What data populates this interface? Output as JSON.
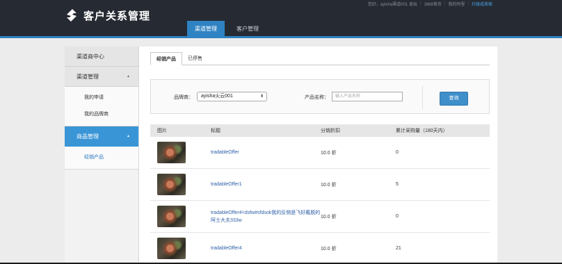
{
  "header": {
    "app_title": "客户关系管理",
    "top_links": {
      "greeting": "您好，ayisha渠道001 退出",
      "home": "1688首页",
      "my_ali": "我的阿里",
      "upgrade": "升级成卖家"
    },
    "nav": [
      {
        "label": "渠道管理"
      },
      {
        "label": "客户管理"
      }
    ]
  },
  "sidebar": {
    "section1": "渠道商中心",
    "section2": "渠道管理",
    "section2_items": [
      "我的申请",
      "我的品牌商"
    ],
    "section3": "商品管理",
    "section3_items": [
      "经销产品"
    ],
    "caret_up": "▲"
  },
  "tabs": [
    {
      "label": "经销产品"
    },
    {
      "label": "已停售"
    }
  ],
  "filter": {
    "brand_label": "品牌商：",
    "brand_value": "ayisha火云001",
    "product_label": "产品名称：",
    "product_placeholder": "输入产品名称",
    "search_button": "查询"
  },
  "table": {
    "headers": [
      "图片",
      "标题",
      "分销折扣",
      "累计采购量（180天内）"
    ],
    "rows": [
      {
        "title": "tradableOffer",
        "discount": "10.0 折",
        "purchases": "0"
      },
      {
        "title": "tradableOffer1",
        "discount": "10.0 折",
        "purchases": "5"
      },
      {
        "title": "tradableOffer4<dsfw#sfdsok我的反侧是飞好戴脱的阿士大夫333w",
        "discount": "10.0 折",
        "purchases": "0"
      },
      {
        "title": "tradableOffer4",
        "discount": "10.0 折",
        "purchases": "21"
      }
    ]
  },
  "colors": {
    "header_bg": "#262b33",
    "accent": "#2f83c3",
    "link": "#2d5fa8"
  }
}
